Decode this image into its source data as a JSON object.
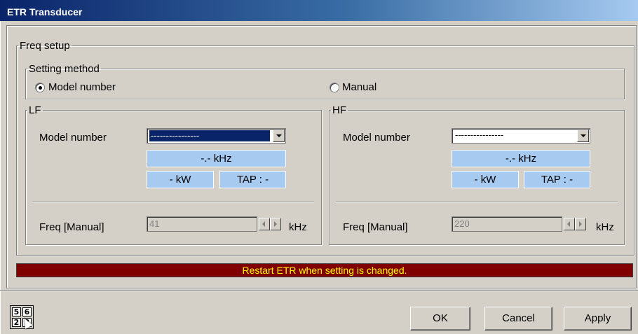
{
  "window": {
    "title": "ETR Transducer"
  },
  "freq_setup": {
    "title": "Freq setup",
    "setting_method": {
      "title": "Setting method",
      "options": [
        {
          "label": "Model number",
          "selected": true
        },
        {
          "label": "Manual",
          "selected": false
        }
      ]
    },
    "lf": {
      "title": "LF",
      "model_label": "Model number",
      "model_value": "----------------",
      "freq_display": "-.- kHz",
      "power_display": "- kW",
      "tap_display": "TAP : -",
      "freq_manual_label": "Freq [Manual]",
      "freq_manual_value": "41",
      "unit": "kHz"
    },
    "hf": {
      "title": "HF",
      "model_label": "Model number",
      "model_value": "----------------",
      "freq_display": "-.- kHz",
      "power_display": "- kW",
      "tap_display": "TAP : -",
      "freq_manual_label": "Freq [Manual]",
      "freq_manual_value": "220",
      "unit": "kHz"
    }
  },
  "warning_banner": "Restart ETR when setting is changed.",
  "grid_icon_digits": [
    "5",
    "6",
    "2",
    "3"
  ],
  "buttons": {
    "ok": "OK",
    "cancel": "Cancel",
    "apply": "Apply"
  },
  "colors": {
    "title_gradient_start": "#0a246a",
    "title_gradient_end": "#a6caf0",
    "info_box": "#a6caf0",
    "banner_bg": "#800000",
    "banner_text": "#ffff00",
    "dialog_bg": "#d4d0c8"
  }
}
